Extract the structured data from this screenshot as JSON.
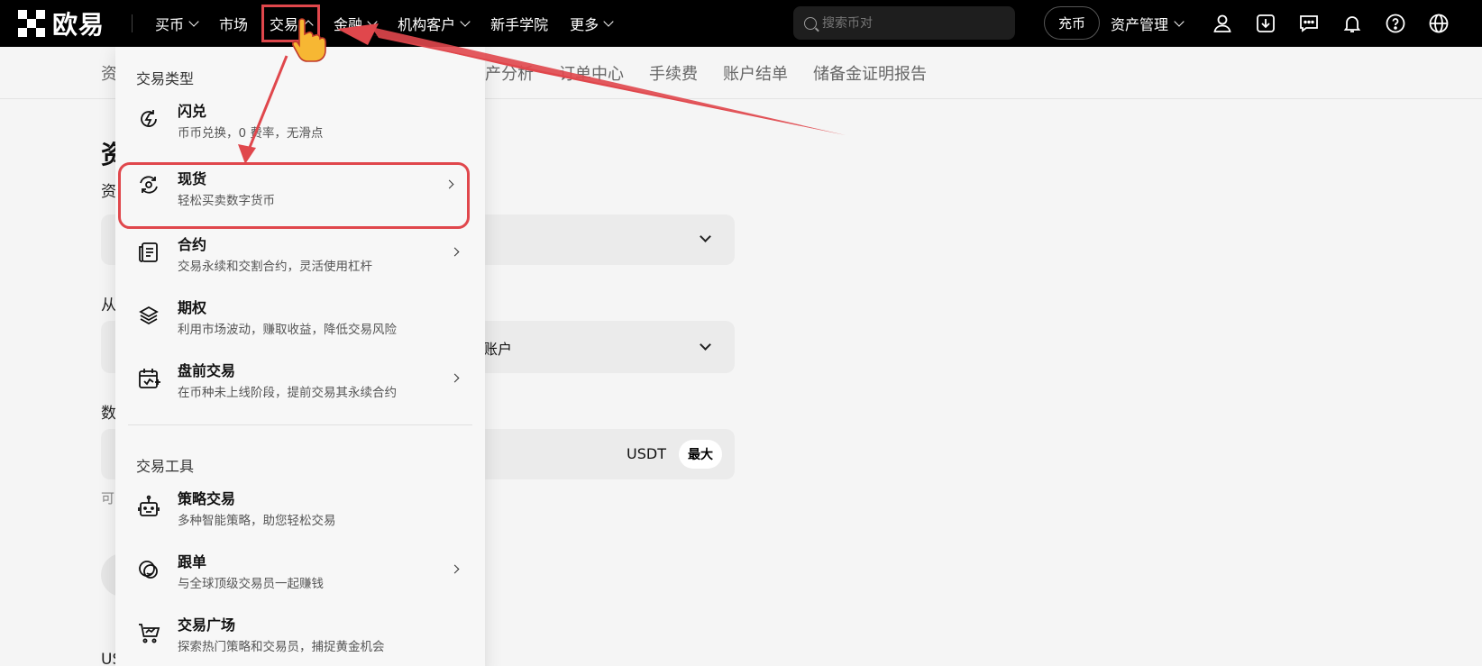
{
  "logo": {
    "text": "欧易"
  },
  "nav": {
    "items": [
      {
        "label": "买币",
        "has_dropdown": true
      },
      {
        "label": "市场",
        "has_dropdown": false
      },
      {
        "label": "交易",
        "has_dropdown": true,
        "active": true
      },
      {
        "label": "金融",
        "has_dropdown": true
      },
      {
        "label": "机构客户",
        "has_dropdown": true
      },
      {
        "label": "新手学院",
        "has_dropdown": false
      },
      {
        "label": "更多",
        "has_dropdown": true
      }
    ]
  },
  "search": {
    "placeholder": "搜索币对"
  },
  "header": {
    "deposit_label": "充币",
    "asset_mgmt_label": "资产管理"
  },
  "subnav": {
    "lead": "资",
    "tabs": [
      "资产分析",
      "订单中心",
      "手续费",
      "账户结单",
      "储备金证明报告"
    ]
  },
  "page": {
    "title": "资",
    "label_1": "资",
    "label_from": "从",
    "label_amount": "数",
    "field_2_text": "账户",
    "unit": "USDT",
    "max_label": "最大",
    "available_prefix": "可",
    "bottom_text": "US"
  },
  "dropdown": {
    "trade_types_title": "交易类型",
    "trade_tools_title": "交易工具",
    "trade_types": [
      {
        "icon": "flash-icon",
        "title": "闪兑",
        "desc": "币币兑换，0 费率，无滑点",
        "arrow": false
      },
      {
        "icon": "spot-icon",
        "title": "现货",
        "desc": "轻松买卖数字货币",
        "arrow": true,
        "highlight": true
      },
      {
        "icon": "contract-icon",
        "title": "合约",
        "desc": "交易永续和交割合约，灵活使用杠杆",
        "arrow": true
      },
      {
        "icon": "layers-icon",
        "title": "期权",
        "desc": "利用市场波动，赚取收益，降低交易风险",
        "arrow": false
      },
      {
        "icon": "calendar-icon",
        "title": "盘前交易",
        "desc": "在币种未上线阶段，提前交易其永续合约",
        "arrow": true
      }
    ],
    "trade_tools": [
      {
        "icon": "robot-icon",
        "title": "策略交易",
        "desc": "多种智能策略，助您轻松交易",
        "arrow": false
      },
      {
        "icon": "copy-trade-icon",
        "title": "跟单",
        "desc": "与全球顶级交易员一起赚钱",
        "arrow": true
      },
      {
        "icon": "cart-icon",
        "title": "交易广场",
        "desc": "探索热门策略和交易员，捕捉黄金机会",
        "arrow": false
      }
    ]
  },
  "colors": {
    "annotation": "#e0474c",
    "topbar": "#000000"
  }
}
